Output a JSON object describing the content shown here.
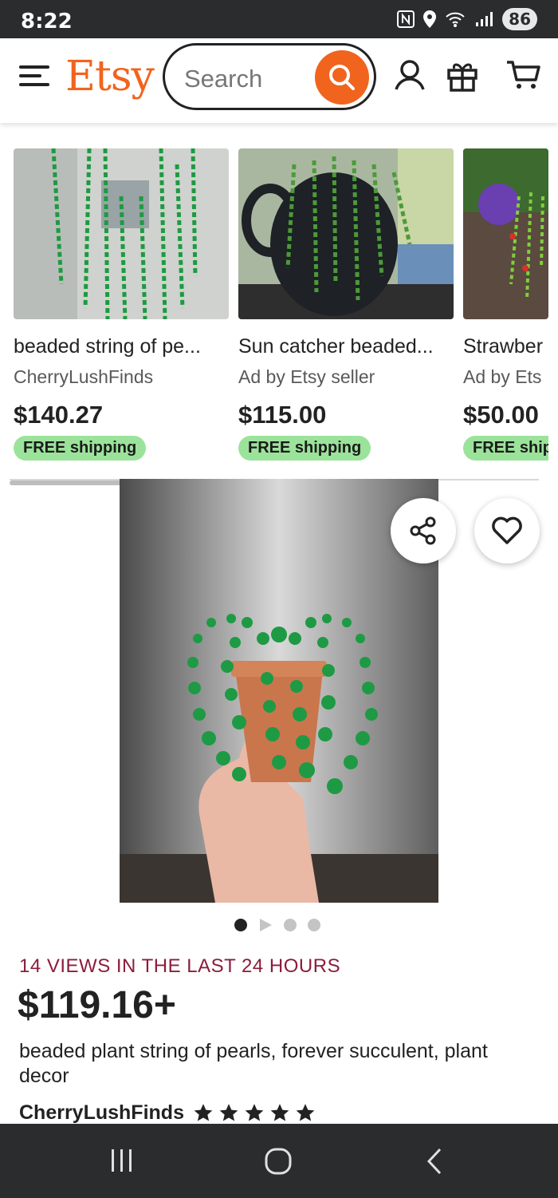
{
  "status_bar": {
    "time": "8:22",
    "battery": "86"
  },
  "header": {
    "logo": "Etsy",
    "search_placeholder": "Search"
  },
  "carousel": [
    {
      "title": "beaded string of pe...",
      "seller": "CherryLushFinds",
      "price": "$140.27",
      "shipping": "FREE shipping"
    },
    {
      "title": "Sun catcher beaded...",
      "seller": "Ad by Etsy seller",
      "price": "$115.00",
      "shipping": "FREE shipping"
    },
    {
      "title": "Strawber",
      "seller": "Ad by Ets",
      "price": "$50.00",
      "shipping": "FREE ship"
    }
  ],
  "listing": {
    "views": "14 VIEWS IN THE LAST 24 HOURS",
    "price": "$119.16+",
    "title": "beaded plant string of pearls, forever succulent, plant decor",
    "shop": "CherryLushFinds",
    "rating_stars": 5,
    "image_count": 4,
    "active_image": 1
  },
  "colors": {
    "brand": "#f1641e",
    "free_shipping_bg": "#9be39b",
    "views_text": "#8c1c3c"
  }
}
